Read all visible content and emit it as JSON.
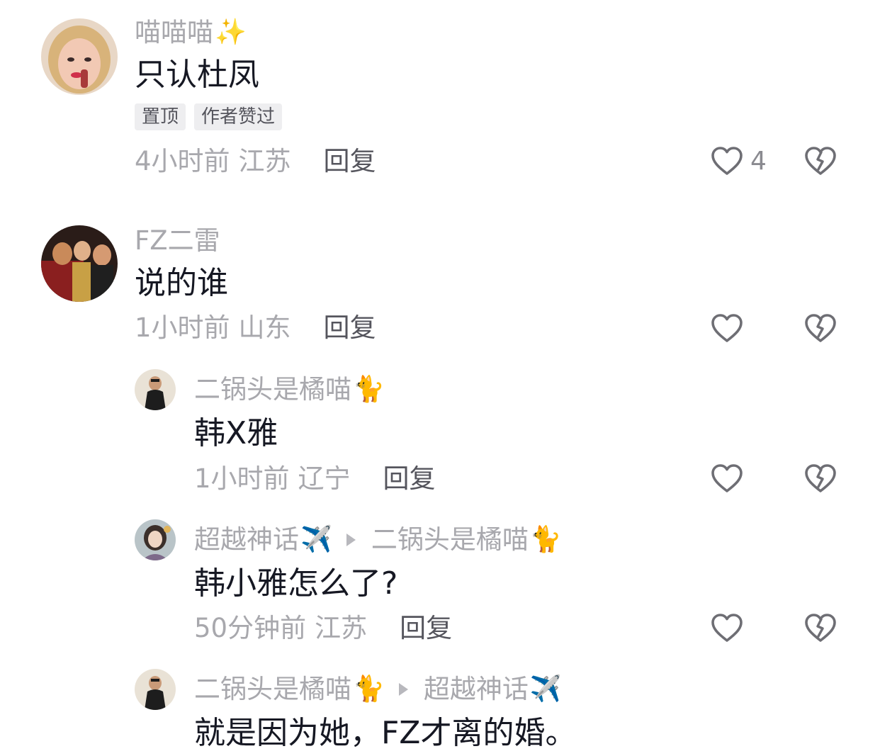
{
  "comments": [
    {
      "username": "喵喵喵",
      "username_emoji": "✨",
      "text": "只认杜凤",
      "tags": [
        "置顶",
        "作者赞过"
      ],
      "time": "4小时前",
      "location": "江苏",
      "reply_label": "回复",
      "like_count": "4"
    },
    {
      "username": "FZ二雷",
      "text": "说的谁",
      "time": "1小时前",
      "location": "山东",
      "reply_label": "回复",
      "like_count": ""
    },
    {
      "username": "二锅头是橘喵",
      "username_emoji": "🐈",
      "text": "韩X雅",
      "time": "1小时前",
      "location": "辽宁",
      "reply_label": "回复",
      "like_count": ""
    },
    {
      "username": "超越神话",
      "username_emoji": "✈️",
      "reply_to": "二锅头是橘喵",
      "reply_to_emoji": "🐈",
      "text": "韩小雅怎么了?",
      "time": "50分钟前",
      "location": "江苏",
      "reply_label": "回复",
      "like_count": ""
    },
    {
      "username": "二锅头是橘喵",
      "username_emoji": "🐈",
      "reply_to": "超越神话",
      "reply_to_emoji": "✈️",
      "text": "就是因为她，FZ才离的婚。"
    }
  ],
  "icons": {
    "like": "heart-outline-icon",
    "dislike": "broken-heart-icon",
    "reply_arrow": "triangle-right-icon"
  },
  "colors": {
    "username": "#a8a8ad",
    "text": "#161823",
    "reply": "#55555d",
    "tag_bg": "#eeeef0",
    "icon": "#6e6e74"
  }
}
